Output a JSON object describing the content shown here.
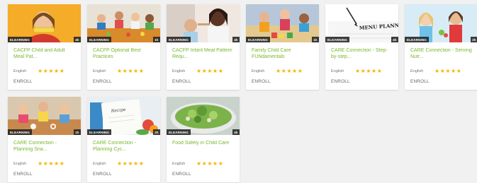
{
  "rating_color": "#f2b705",
  "title_color": "#76b82a",
  "courses": [
    {
      "type": "ELEARNING",
      "duration": "4h",
      "title": "CACFP Child and Adult Meal Pat...",
      "language": "English",
      "rating": 5,
      "action": "ENROLL",
      "image": "girl-eating-corn"
    },
    {
      "type": "ELEARNING",
      "duration": "1h",
      "title": "CACFP Optional Best Practices",
      "language": "English",
      "rating": 5,
      "action": "ENROLL",
      "image": "children-at-lunch-table"
    },
    {
      "type": "ELEARNING",
      "duration": "4h",
      "title": "CACFP Infant Meal Pattern Requ...",
      "language": "English",
      "rating": 5,
      "action": "ENROLL",
      "image": "mother-feeding-infant"
    },
    {
      "type": "ELEARNING",
      "duration": "1h",
      "title": "Family Child Care FUNdamentals",
      "language": "English",
      "rating": 5,
      "action": "ENROLL",
      "image": "children-playing-blocks"
    },
    {
      "type": "ELEARNING",
      "duration": "4h",
      "title": "CARE Connection - Step-by-step...",
      "language": "English",
      "rating": 5,
      "action": "ENROLL",
      "image": "menu-planner-paper",
      "image_text": "MENU PLANNER"
    },
    {
      "type": "ELEARNING",
      "duration": "2h",
      "title": "CARE Connection - Serving Nutr...",
      "language": "English",
      "rating": 5,
      "action": "ENROLL",
      "image": "girls-eating-fruit"
    },
    {
      "type": "ELEARNING",
      "duration": "1h",
      "title": "CARE Connection - Planning Sna...",
      "language": "English",
      "rating": 5,
      "action": "ENROLL",
      "image": "kids-snack-time"
    },
    {
      "type": "ELEARNING",
      "duration": "2h",
      "title": "CARE Connection - Planning Cyc...",
      "language": "English",
      "rating": 5,
      "action": "ENROLL",
      "image": "recipe-book-with-vegetables",
      "image_text": "Recipe"
    },
    {
      "type": "ELEARNING",
      "duration": "4h",
      "title": "Food Safety in Child Care",
      "language": "English",
      "rating": 5,
      "action": "ENROLL",
      "image": "salad-bowl"
    }
  ]
}
